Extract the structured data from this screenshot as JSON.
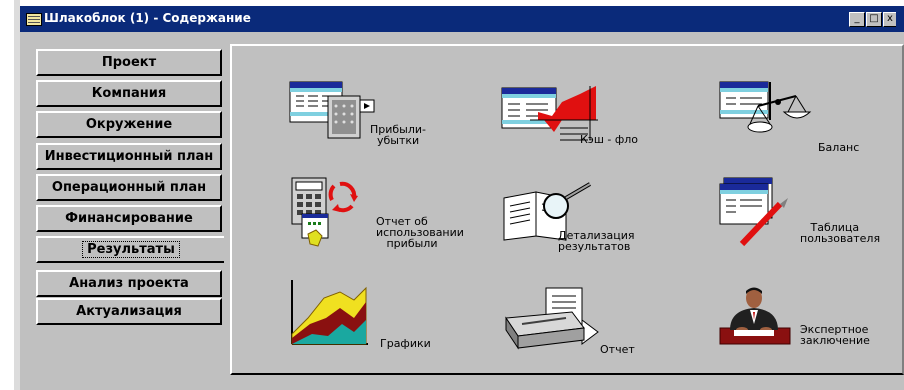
{
  "window": {
    "title": "Шлакоблок (1) - Содержание",
    "buttons": {
      "minimize": "_",
      "maximize": "□",
      "close": "x"
    }
  },
  "tabs": [
    {
      "label": "Проект"
    },
    {
      "label": "Компания"
    },
    {
      "label": "Окружение"
    },
    {
      "label": "Инвестиционный план"
    },
    {
      "label": "Операционный план"
    },
    {
      "label": "Финансирование"
    },
    {
      "label": "Результаты",
      "active": true
    },
    {
      "label": "Анализ проекта"
    },
    {
      "label": "Актуализация"
    }
  ],
  "items": {
    "profit_loss": {
      "label": "Прибыли-\n  убытки",
      "icon": "spreadsheet-calculator-icon"
    },
    "cash_flow": {
      "label": "Кэш - фло",
      "icon": "cash-flow-chart-icon"
    },
    "balance": {
      "label": "Баланс",
      "icon": "scales-icon"
    },
    "profit_usage": {
      "label": "Отчет об\nиспользовании\n   прибыли",
      "icon": "calculator-arrows-icon"
    },
    "detailing": {
      "label": "Детализация\nрезультатов",
      "icon": "magnifier-book-icon"
    },
    "user_table": {
      "label": "   Таблица\nпользователя",
      "icon": "table-pencil-icon"
    },
    "charts": {
      "label": "Графики",
      "icon": "area-chart-icon"
    },
    "report": {
      "label": "Отчет",
      "icon": "printer-icon"
    },
    "expert": {
      "label": "Экспертное\nзаключение",
      "icon": "expert-person-icon"
    }
  }
}
